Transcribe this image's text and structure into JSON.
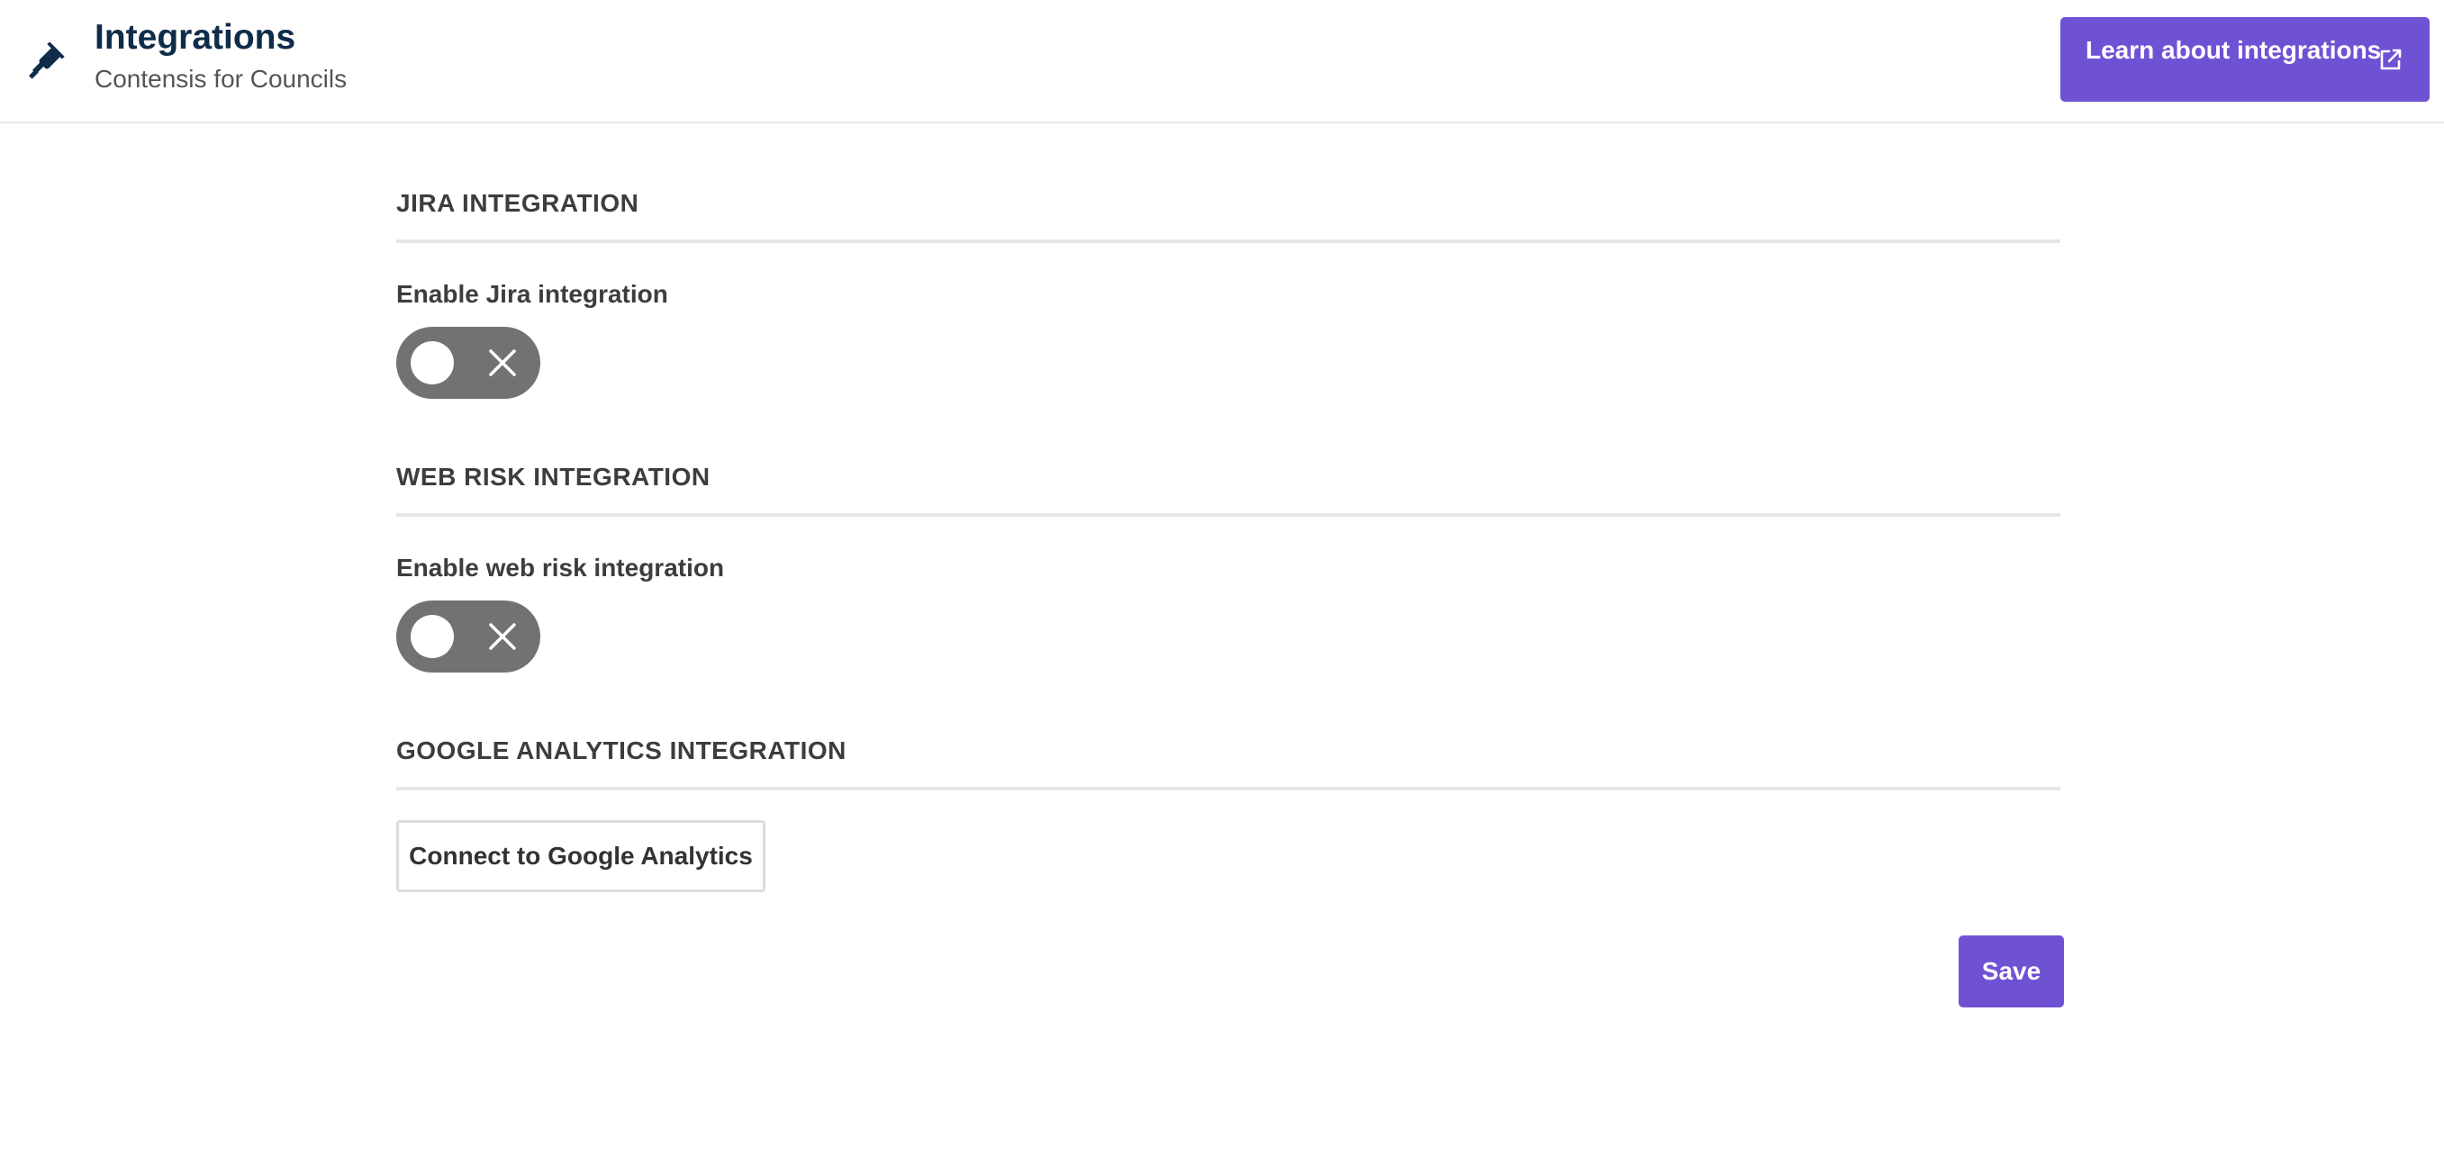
{
  "header": {
    "icon": "plug-icon",
    "title": "Integrations",
    "subtitle": "Contensis for Councils",
    "learn_button_label": "Learn about integrations",
    "learn_button_icon": "external-link-icon"
  },
  "sections": {
    "jira": {
      "heading": "JIRA INTEGRATION",
      "field_label": "Enable Jira integration",
      "toggle_state": "off"
    },
    "web_risk": {
      "heading": "WEB RISK INTEGRATION",
      "field_label": "Enable web risk integration",
      "toggle_state": "off"
    },
    "google_analytics": {
      "heading": "GOOGLE ANALYTICS INTEGRATION",
      "connect_button_label": "Connect to Google Analytics"
    }
  },
  "actions": {
    "save_label": "Save"
  },
  "colors": {
    "accent": "#6f52d4",
    "title": "#0f2c4a",
    "toggle_off": "#727272"
  }
}
